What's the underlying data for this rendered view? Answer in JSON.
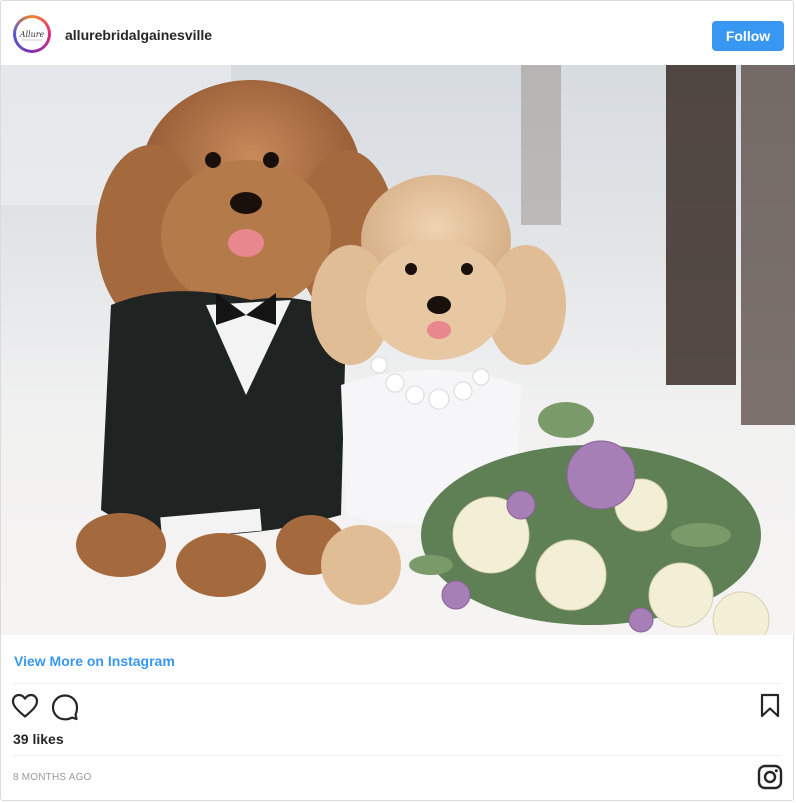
{
  "post": {
    "username": "allurebridalgainesville",
    "avatar_text": "Allure",
    "follow_label": "Follow",
    "photo_description_icon": "poodle-wedding-photo",
    "view_more_label": "View More on Instagram",
    "likes_text": "39 likes",
    "timestamp": "8 MONTHS AGO"
  },
  "icons": {
    "like": "heart-icon",
    "comment": "comment-icon",
    "save": "bookmark-icon",
    "instagram": "instagram-icon"
  },
  "colors": {
    "accent": "#3897f0",
    "text": "#262626",
    "muted": "#999999",
    "border": "#dbdbdb"
  }
}
